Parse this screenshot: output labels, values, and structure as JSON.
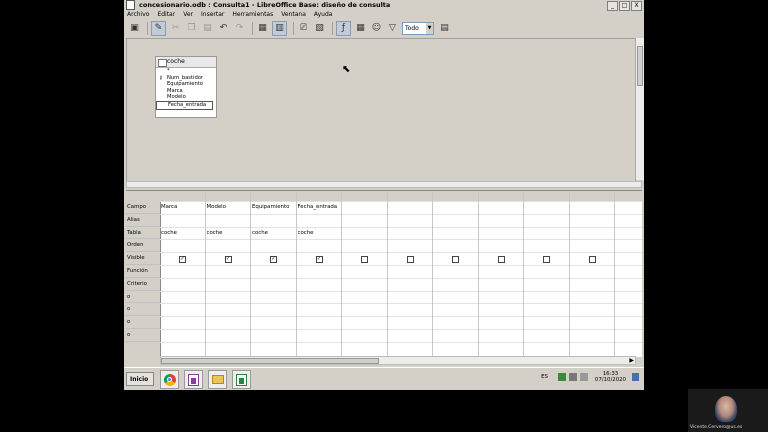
{
  "window": {
    "title": "concesionario.odb : Consulta1 - LibreOffice Base: diseño de consulta",
    "buttons": [
      "_",
      "□",
      "X"
    ]
  },
  "menu": [
    "Archivo",
    "Editar",
    "Ver",
    "Insertar",
    "Herramientas",
    "Ventana",
    "Ayuda"
  ],
  "toolbar": {
    "limit_select": "Todo"
  },
  "table_widget": {
    "name": "coche",
    "star": "*",
    "key_symbol": "⚷",
    "fields": [
      "Num_bastidor",
      "Equipamiento",
      "Marca",
      "Modelo",
      "Fecha_entrada"
    ]
  },
  "grid": {
    "row_labels": [
      "Campo",
      "Alias",
      "Tabla",
      "Orden",
      "Visible",
      "Función",
      "Criterio",
      "o",
      "o",
      "o",
      "o"
    ],
    "columns": [
      {
        "campo": "Marca",
        "tabla": "coche",
        "visible": true
      },
      {
        "campo": "Modelo",
        "tabla": "coche",
        "visible": true
      },
      {
        "campo": "Equipamiento",
        "tabla": "coche",
        "visible": true
      },
      {
        "campo": "Fecha_entrada",
        "tabla": "coche",
        "visible": true
      },
      {
        "campo": "",
        "tabla": "",
        "visible": false
      },
      {
        "campo": "",
        "tabla": "",
        "visible": false
      },
      {
        "campo": "",
        "tabla": "",
        "visible": false
      },
      {
        "campo": "",
        "tabla": "",
        "visible": false
      },
      {
        "campo": "",
        "tabla": "",
        "visible": false
      },
      {
        "campo": "",
        "tabla": "",
        "visible": false
      }
    ],
    "check_mark": "✓"
  },
  "taskbar": {
    "start_label": "Inicio",
    "apps": [
      "chrome-icon",
      "libreoffice-base-icon",
      "file-explorer-icon",
      "libreoffice-calc-icon"
    ],
    "language": "ES",
    "time": "16:33",
    "date": "07/10/2020"
  },
  "webcam": {
    "name": "Vicente.Cervero@us.es"
  }
}
